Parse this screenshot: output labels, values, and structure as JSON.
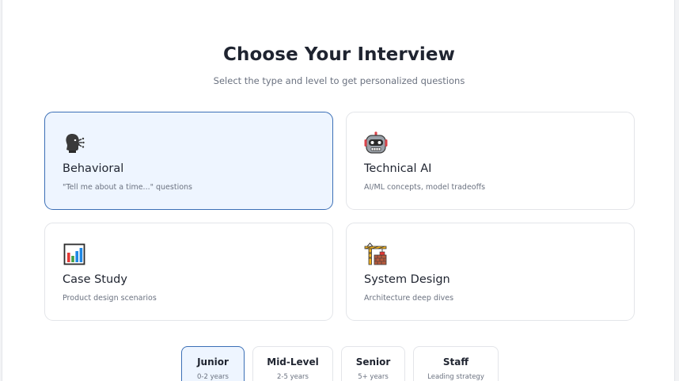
{
  "header": {
    "title": "Choose Your Interview",
    "subtitle": "Select the type and level to get personalized questions"
  },
  "interview_types": [
    {
      "name": "Behavioral",
      "description": "\"Tell me about a time...\" questions",
      "icon": "speaking-head-icon",
      "selected": true
    },
    {
      "name": "Technical AI",
      "description": "AI/ML concepts, model tradeoffs",
      "icon": "robot-icon",
      "selected": false
    },
    {
      "name": "Case Study",
      "description": "Product design scenarios",
      "icon": "bar-chart-icon",
      "selected": false
    },
    {
      "name": "System Design",
      "description": "Architecture deep dives",
      "icon": "building-construction-icon",
      "selected": false
    }
  ],
  "levels": [
    {
      "name": "Junior",
      "range": "0-2 years",
      "selected": true
    },
    {
      "name": "Mid-Level",
      "range": "2-5 years",
      "selected": false
    },
    {
      "name": "Senior",
      "range": "5+ years",
      "selected": false
    },
    {
      "name": "Staff",
      "range": "Leading strategy",
      "selected": false
    }
  ],
  "colors": {
    "accent": "#3b6fb6",
    "selected_background": "#eef5ff",
    "text": "#1f2430",
    "muted_text": "#6b7280"
  }
}
